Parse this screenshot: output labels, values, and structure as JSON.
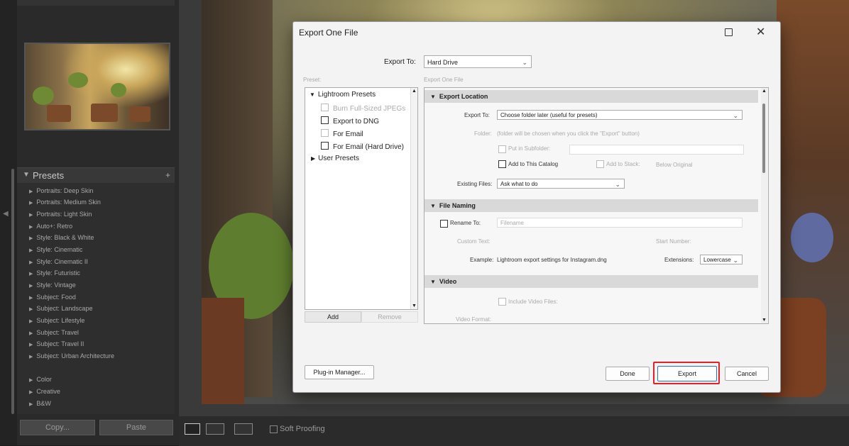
{
  "left_panel": {
    "presets_title": "Presets",
    "presets": [
      "Portraits: Deep Skin",
      "Portraits: Medium Skin",
      "Portraits: Light Skin",
      "Auto+: Retro",
      "Style: Black & White",
      "Style: Cinematic",
      "Style: Cinematic II",
      "Style: Futuristic",
      "Style: Vintage",
      "Subject: Food",
      "Subject: Landscape",
      "Subject: Lifestyle",
      "Subject: Travel",
      "Subject: Travel II",
      "Subject: Urban Architecture",
      "Color",
      "Creative",
      "B&W"
    ],
    "copy_label": "Copy...",
    "paste_label": "Paste"
  },
  "toolbar": {
    "soft_proofing_label": "Soft Proofing"
  },
  "dialog": {
    "title": "Export One File",
    "export_to_label": "Export To:",
    "export_to_value": "Hard Drive",
    "preset_column_label": "Preset:",
    "export_column_label": "Export One File",
    "preset_tree": {
      "lightroom_presets": "Lightroom Presets",
      "items": [
        "Burn Full-Sized JPEGs",
        "Export to DNG",
        "For Email",
        "For Email (Hard Drive)"
      ],
      "user_presets": "User Presets"
    },
    "add_label": "Add",
    "remove_label": "Remove",
    "export_location": {
      "header": "Export Location",
      "export_to_label": "Export To:",
      "export_to_value": "Choose folder later (useful for presets)",
      "folder_label": "Folder:",
      "folder_value": "(folder will be chosen when you click the \"Export\" button)",
      "subfolder_label": "Put in Subfolder:",
      "add_catalog_label": "Add to This Catalog",
      "add_stack_label": "Add to Stack:",
      "stack_value": "Below Original",
      "existing_files_label": "Existing Files:",
      "existing_files_value": "Ask what to do"
    },
    "file_naming": {
      "header": "File Naming",
      "rename_label": "Rename To:",
      "rename_value": "Filename",
      "custom_text_label": "Custom Text:",
      "start_number_label": "Start Number:",
      "example_label": "Example:",
      "example_value": "Lightroom export settings for Instagram.dng",
      "extensions_label": "Extensions:",
      "extensions_value": "Lowercase"
    },
    "video": {
      "header": "Video",
      "include_video_label": "Include Video Files:",
      "video_format_label": "Video Format:"
    },
    "plugin_manager_label": "Plug-in Manager...",
    "done_label": "Done",
    "export_label": "Export",
    "cancel_label": "Cancel",
    "highlight_color": "#e2222a"
  }
}
